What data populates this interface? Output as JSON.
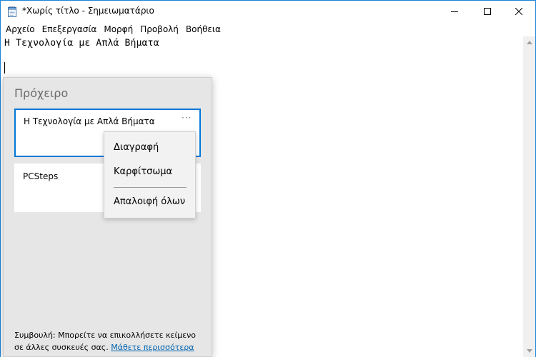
{
  "window": {
    "title": "*Χωρίς τίτλο - Σημειωματάριο",
    "accent_color": "#1883d7"
  },
  "titlebar_icons": {
    "app": "notepad-icon",
    "minimize": "minimize-icon",
    "maximize": "maximize-icon",
    "close": "close-icon"
  },
  "menubar": {
    "items": [
      "Αρχείο",
      "Επεξεργασία",
      "Μορφή",
      "Προβολή",
      "Βοήθεια"
    ]
  },
  "editor": {
    "lines": [
      "Η Τεχνολογία με Απλά Βήματα"
    ]
  },
  "clipboard": {
    "title": "Πρόχειρο",
    "items": [
      {
        "text": "Η Τεχνολογία με Απλά Βήματα",
        "selected": true,
        "more_label": "···"
      },
      {
        "text": "PCSteps",
        "selected": false
      }
    ],
    "tip": "Συμβουλή: Μπορείτε να επικολλήσετε κείμενο σε άλλες συσκευές σας.",
    "link": "Μάθετε περισσότερα",
    "selection_color": "#0078d7",
    "link_color": "#0063b1"
  },
  "context_menu": {
    "items": [
      "Διαγραφή",
      "Καρφίτσωμα",
      "Απαλοιφή όλων"
    ]
  }
}
